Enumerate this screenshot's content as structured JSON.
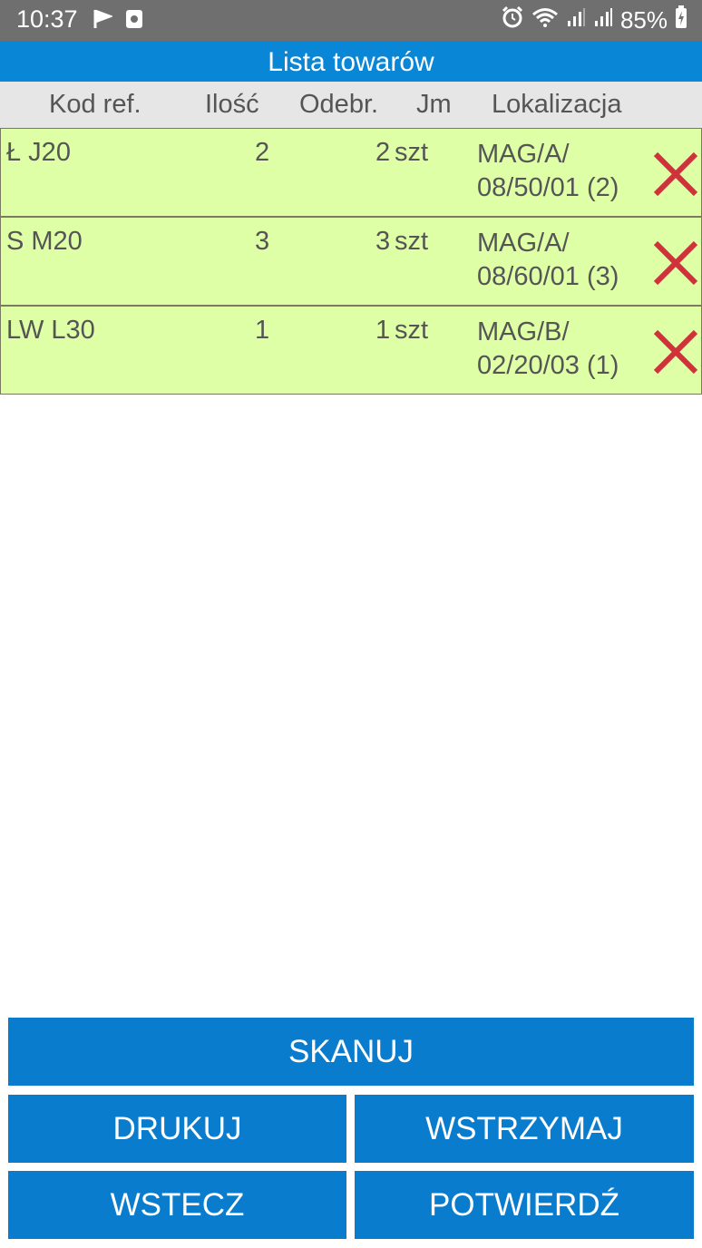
{
  "status_bar": {
    "time": "10:37",
    "battery": "85%",
    "icons": [
      "flag-notification-icon",
      "screenshot-icon",
      "alarm-icon",
      "wifi-icon",
      "signal-icon",
      "signal-icon",
      "battery-charging-icon"
    ]
  },
  "title": "Lista towarów",
  "columns": {
    "ref": "Kod ref.",
    "qty": "Ilość",
    "picked": "Odebr.",
    "unit": "Jm",
    "location": "Lokalizacja"
  },
  "rows": [
    {
      "ref": "Ł J20",
      "qty": "2",
      "picked": "2",
      "unit": "szt",
      "loc1": "MAG/A/",
      "loc2": "08/50/01 (2)"
    },
    {
      "ref": "S M20",
      "qty": "3",
      "picked": "3",
      "unit": "szt",
      "loc1": "MAG/A/",
      "loc2": "08/60/01 (3)"
    },
    {
      "ref": "LW L30",
      "qty": "1",
      "picked": "1",
      "unit": "szt",
      "loc1": "MAG/B/",
      "loc2": "02/20/03 (1)"
    }
  ],
  "buttons": {
    "scan": "SKANUJ",
    "print": "DRUKUJ",
    "hold": "WSTRZYMAJ",
    "back": "WSTECZ",
    "confirm": "POTWIERDŹ"
  },
  "colors": {
    "status_bar": "#6f6f6f",
    "title_bar": "#0a86d6",
    "row_bg": "#dfffa6",
    "button": "#0a7ccd",
    "delete": "#d0323c"
  }
}
